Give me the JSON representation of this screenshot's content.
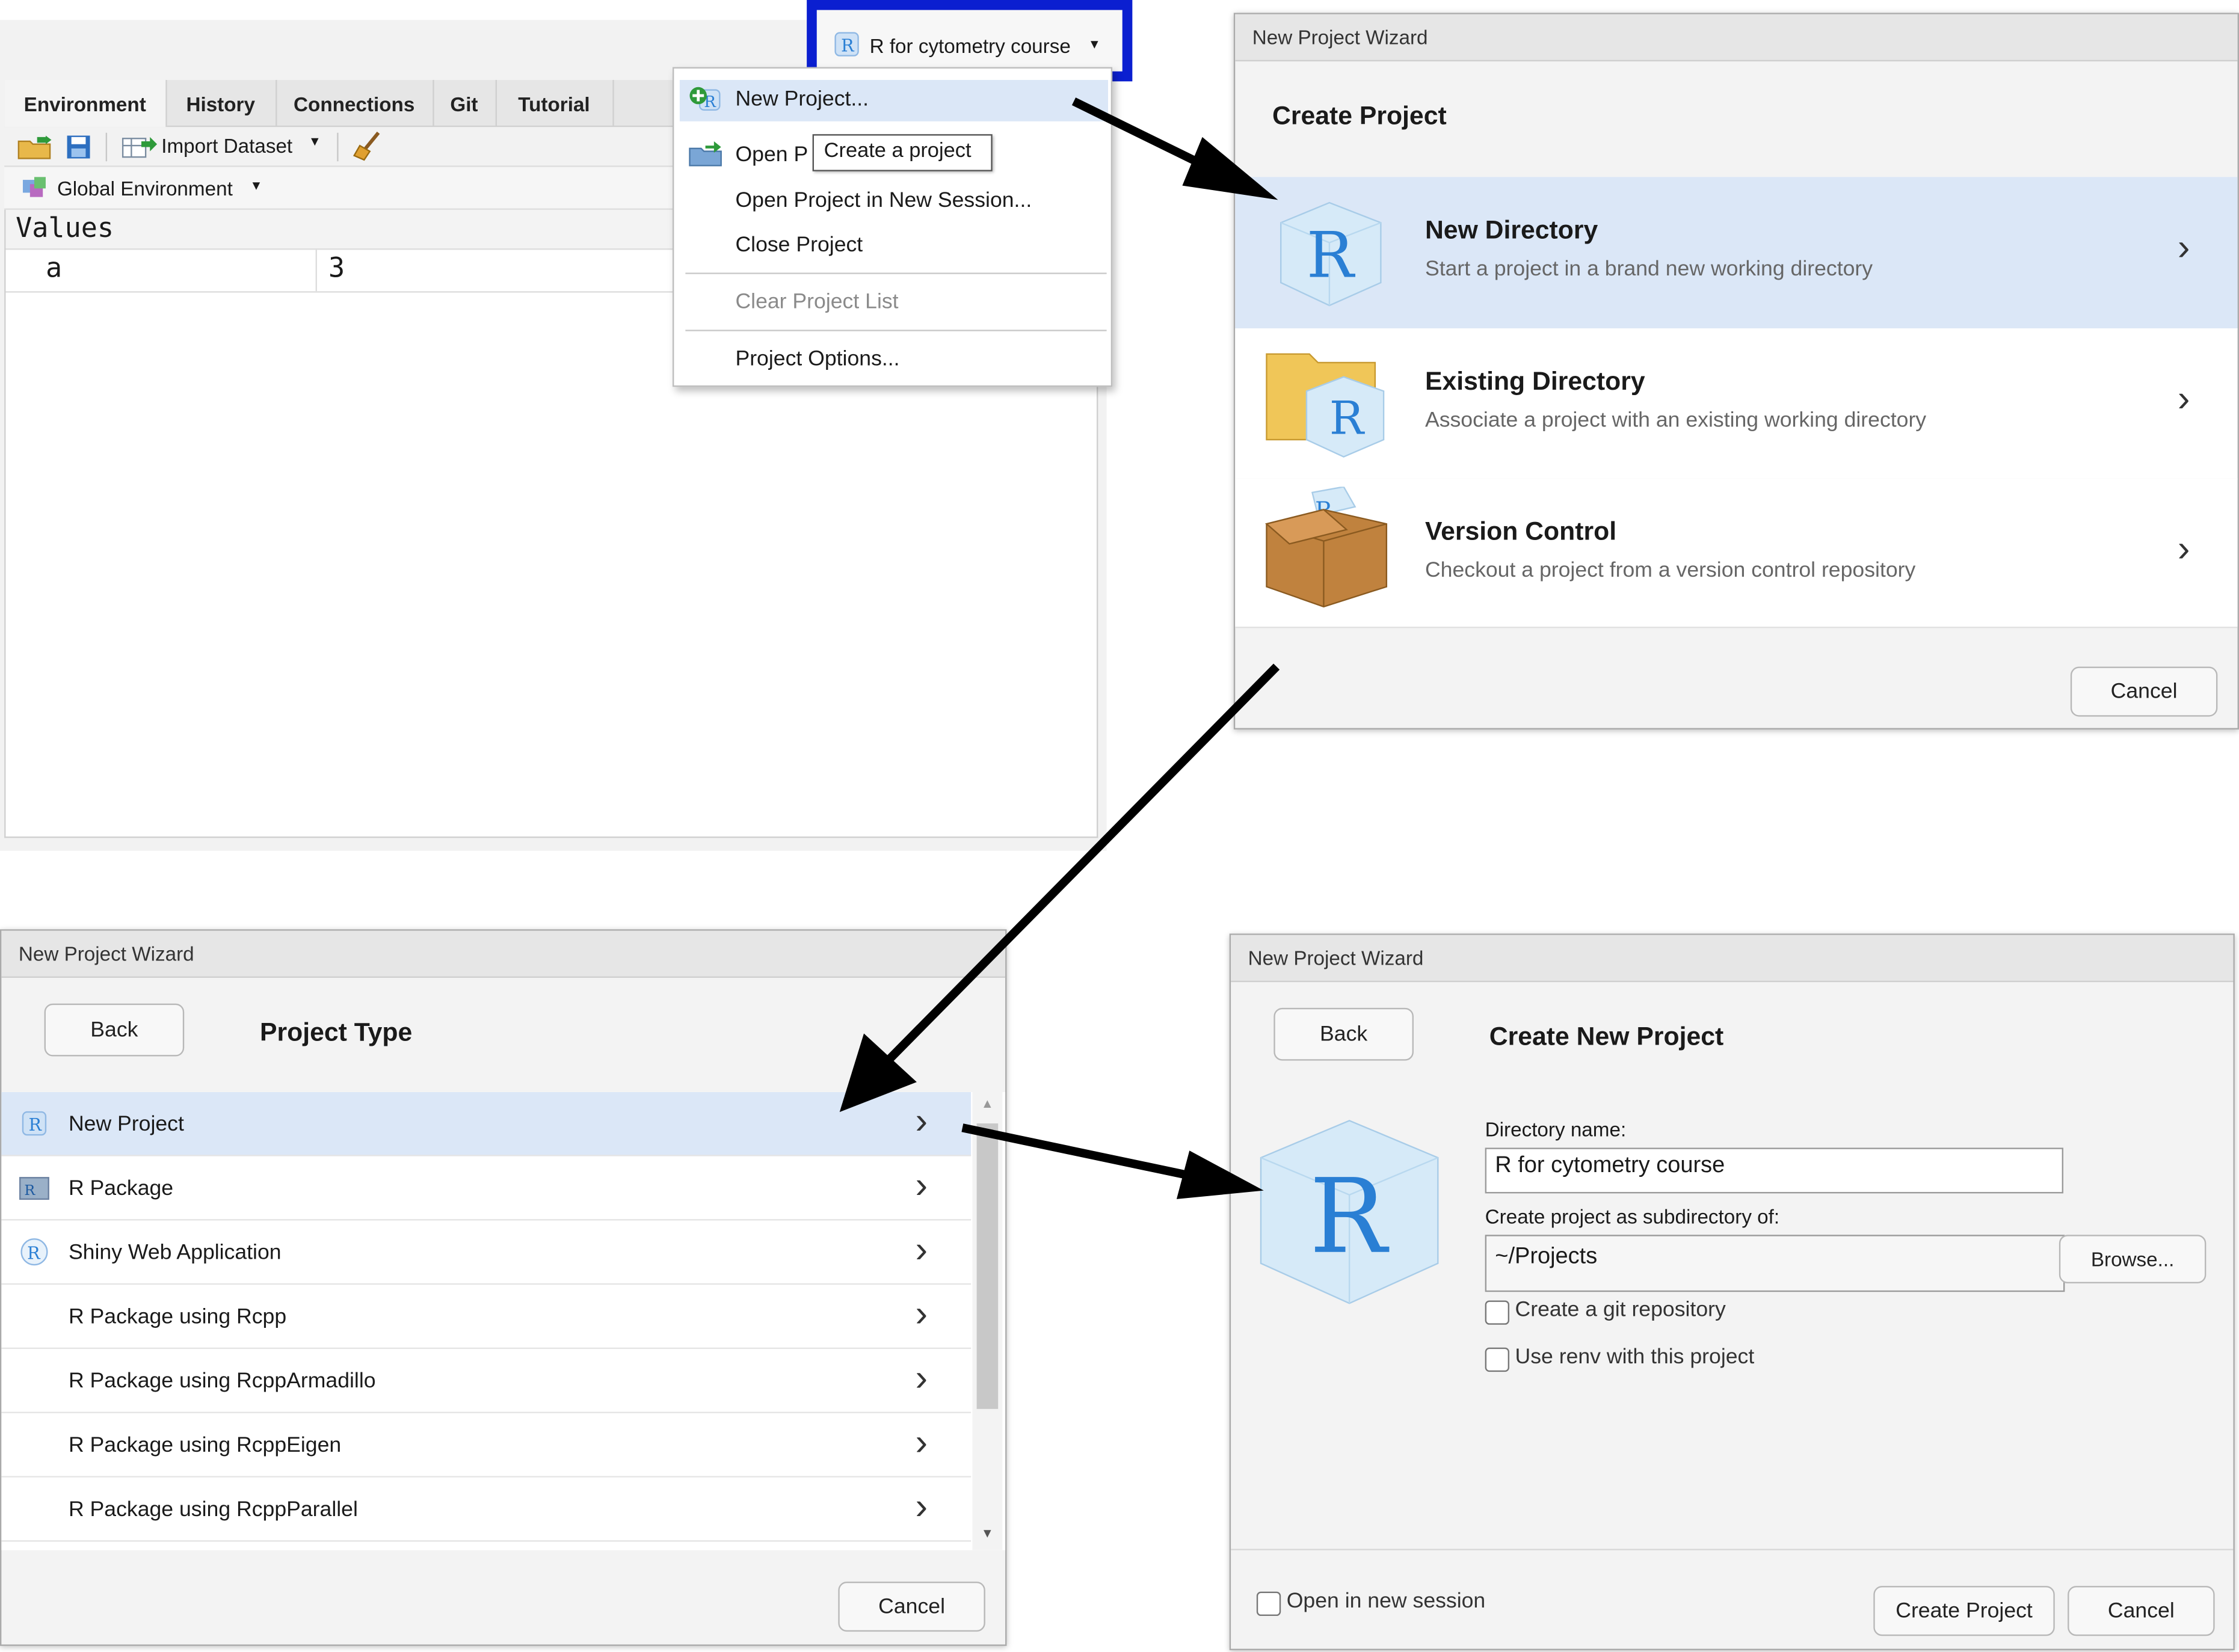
{
  "env_pane": {
    "tabs": [
      "Environment",
      "History",
      "Connections",
      "Git",
      "Tutorial"
    ],
    "import_dataset": "Import Dataset",
    "global_env": "Global Environment",
    "values_header": "Values",
    "var_name": "a",
    "var_value": "3"
  },
  "project_button": {
    "label": "R for cytometry course"
  },
  "project_menu": {
    "new_project": "New Project...",
    "open_project": "Open P",
    "tooltip": "Create a project",
    "open_new_session": "Open Project in New Session...",
    "close_project": "Close Project",
    "clear_list": "Clear Project List",
    "options": "Project Options..."
  },
  "wizard1": {
    "window_title": "New Project Wizard",
    "heading": "Create Project",
    "options": [
      {
        "title": "New Directory",
        "desc": "Start a project in a brand new working directory",
        "icon": "r-cube-icon"
      },
      {
        "title": "Existing Directory",
        "desc": "Associate a project with an existing working directory",
        "icon": "folder-r-icon"
      },
      {
        "title": "Version Control",
        "desc": "Checkout a project from a version control repository",
        "icon": "box-icon"
      }
    ],
    "cancel": "Cancel"
  },
  "wizard2": {
    "window_title": "New Project Wizard",
    "back": "Back",
    "heading": "Project Type",
    "items": [
      "New Project",
      "R Package",
      "Shiny Web Application",
      "R Package using Rcpp",
      "R Package using RcppArmadillo",
      "R Package using RcppEigen",
      "R Package using RcppParallel"
    ],
    "cancel": "Cancel"
  },
  "wizard3": {
    "window_title": "New Project Wizard",
    "back": "Back",
    "heading": "Create New Project",
    "dir_label": "Directory name:",
    "dir_value": "R for cytometry course",
    "sub_label": "Create project as subdirectory of:",
    "sub_value": "~/Projects",
    "browse": "Browse...",
    "git_label": "Create a git repository",
    "renv_label": "Use renv with this project",
    "open_new_session": "Open in new session",
    "create": "Create Project",
    "cancel": "Cancel"
  },
  "colors": {
    "highlight_border": "#0b1fd0",
    "selected_row": "#dbe7f7",
    "r_blue": "#2a7fd4"
  }
}
